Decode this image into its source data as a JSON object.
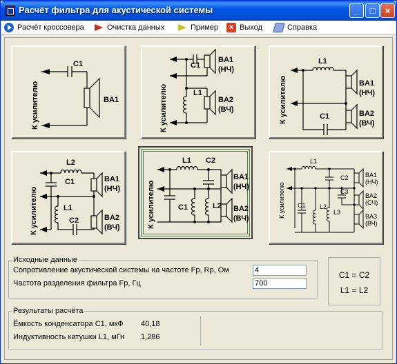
{
  "window": {
    "title": "Расчёт фильтра для акустической системы"
  },
  "menu": [
    {
      "label": "Расчёт кроссовера",
      "icon": "play-circle-icon"
    },
    {
      "label": "Очистка данных",
      "icon": "red-arrow-icon"
    },
    {
      "label": "Пример",
      "icon": "yellow-arrow-icon"
    },
    {
      "label": "Выход",
      "icon": "close-x-icon"
    },
    {
      "label": "Справка",
      "icon": "help-book-icon"
    }
  ],
  "circuits": {
    "to_amp": "К усилителю",
    "c1": "C1",
    "c2": "C2",
    "c3": "C3",
    "l1": "L1",
    "l2": "L2",
    "l3": "L3",
    "ba1": "BA1",
    "ba2": "BA2",
    "ba3": "BA3",
    "lf": "(НЧ)",
    "hf": "(ВЧ)",
    "mf": "(СЧ)"
  },
  "input_section": {
    "legend": "Исходные данные",
    "impedance_label": "Сопротивление акустической системы на частоте Fр, Rр, Ом",
    "impedance_value": "4",
    "freq_label": "Частота разделения фильтра Fр, Гц",
    "freq_value": "700"
  },
  "equality": {
    "line1": "C1 = C2",
    "line2": "L1 = L2"
  },
  "results": {
    "legend": "Результаты расчёта",
    "cap_label": "Ёмкость конденсатора C1, мкФ",
    "cap_value": "40,18",
    "ind_label": "Индуктивность катушки L1, мГн",
    "ind_value": "1,286"
  }
}
